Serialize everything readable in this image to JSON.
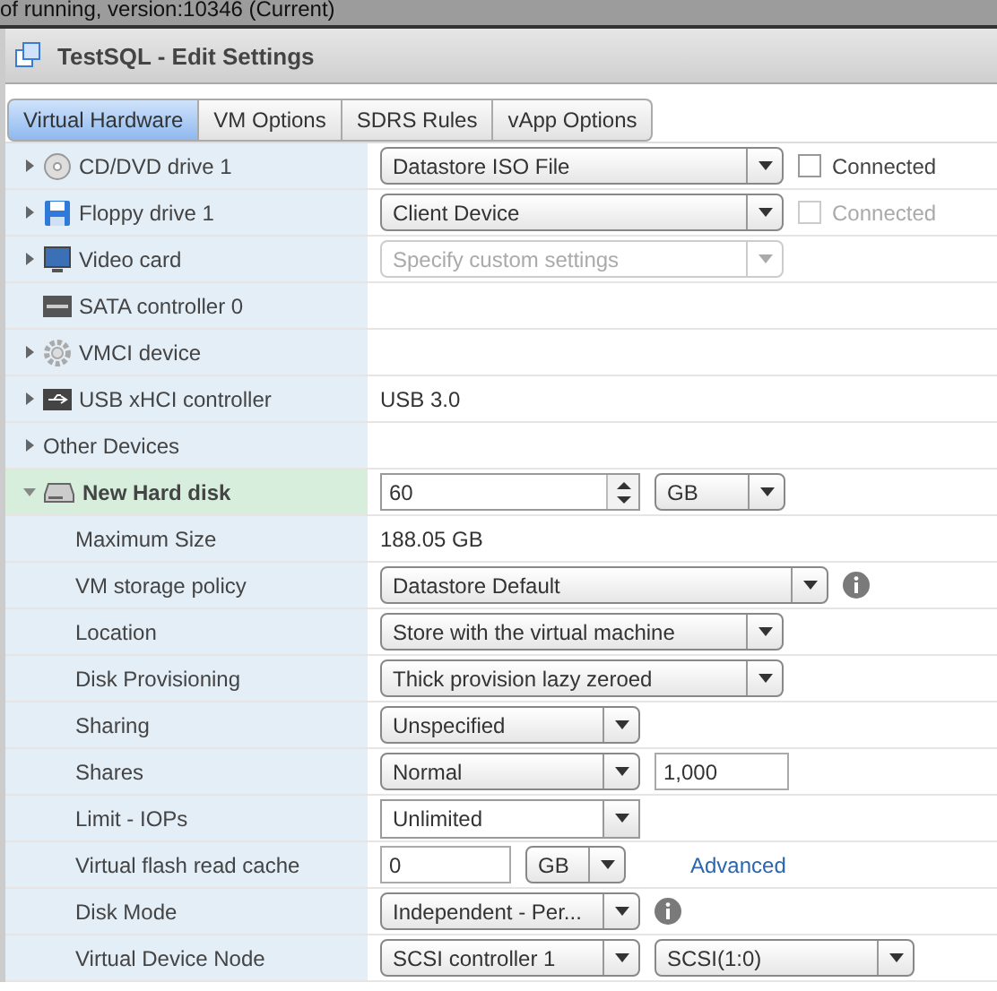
{
  "background_text": "of running, version:10346 (Current)",
  "window": {
    "title": "TestSQL - Edit Settings"
  },
  "tabs": [
    {
      "label": "Virtual Hardware",
      "selected": true
    },
    {
      "label": "VM Options",
      "selected": false
    },
    {
      "label": "SDRS Rules",
      "selected": false
    },
    {
      "label": "vApp Options",
      "selected": false
    }
  ],
  "devices": [
    {
      "kind": "cd-drive",
      "label": "CD/DVD drive 1",
      "expanded": false,
      "selected": false,
      "controls": [
        {
          "kind": "dropdown",
          "value": "Datastore ISO File",
          "disabled": false
        },
        {
          "kind": "checkbox",
          "label": "Connected",
          "checked": false,
          "disabled": false
        }
      ]
    },
    {
      "kind": "floppy",
      "label": "Floppy drive 1",
      "expanded": false,
      "selected": false,
      "controls": [
        {
          "kind": "dropdown",
          "value": "Client Device",
          "disabled": false
        },
        {
          "kind": "checkbox",
          "label": "Connected",
          "checked": false,
          "disabled": true
        }
      ]
    },
    {
      "kind": "video-card",
      "label": "Video card",
      "expanded": false,
      "selected": false,
      "controls": [
        {
          "kind": "dropdown",
          "value": "Specify custom settings",
          "disabled": true
        }
      ]
    },
    {
      "kind": "sata",
      "label": "SATA controller 0",
      "selected": false
    },
    {
      "kind": "vmci",
      "label": "VMCI device",
      "expanded": false,
      "selected": false
    },
    {
      "kind": "usb",
      "label": "USB xHCI controller",
      "expanded": false,
      "selected": false,
      "controls": [
        {
          "kind": "value",
          "value": "USB 3.0"
        }
      ]
    },
    {
      "kind": "group",
      "label": "Other Devices",
      "expanded": false,
      "selected": false
    },
    {
      "kind": "hard-disk",
      "label": "New Hard disk",
      "expanded": true,
      "selected": true,
      "controls": [
        {
          "kind": "spinner",
          "value": "60"
        },
        {
          "kind": "unit-dropdown",
          "value": "GB",
          "disabled": false
        }
      ],
      "children": [
        {
          "label": "Maximum Size",
          "controls": [
            {
              "kind": "value",
              "value": "188.05 GB"
            }
          ]
        },
        {
          "label": "VM storage policy",
          "controls": [
            {
              "kind": "wide-dropdown",
              "value": "Datastore Default",
              "disabled": false
            },
            {
              "kind": "info"
            }
          ]
        },
        {
          "label": "Location",
          "controls": [
            {
              "kind": "dropdown",
              "value": "Store with the virtual machine",
              "disabled": false
            }
          ]
        },
        {
          "label": "Disk Provisioning",
          "controls": [
            {
              "kind": "dropdown",
              "value": "Thick provision lazy zeroed",
              "disabled": false
            }
          ]
        },
        {
          "label": "Sharing",
          "controls": [
            {
              "kind": "short-dropdown",
              "value": "Unspecified",
              "disabled": false
            }
          ]
        },
        {
          "label": "Shares",
          "controls": [
            {
              "kind": "short-dropdown",
              "value": "Normal",
              "disabled": false
            },
            {
              "kind": "field",
              "value": "1,000"
            }
          ]
        },
        {
          "label": "Limit - IOPs",
          "controls": [
            {
              "kind": "combo",
              "value": "Unlimited"
            }
          ]
        },
        {
          "label": "Virtual flash read cache",
          "controls": [
            {
              "kind": "small-field",
              "value": "0"
            },
            {
              "kind": "mini-dropdown",
              "value": "GB",
              "disabled": false
            },
            {
              "kind": "link",
              "label": "Advanced"
            }
          ]
        },
        {
          "label": "Disk Mode",
          "controls": [
            {
              "kind": "short-dropdown",
              "value": "Independent - Per...",
              "disabled": false
            },
            {
              "kind": "info"
            }
          ]
        },
        {
          "label": "Virtual Device Node",
          "controls": [
            {
              "kind": "short-dropdown",
              "value": "SCSI controller 1",
              "disabled": false
            },
            {
              "kind": "short-dropdown",
              "value": "SCSI(1:0)",
              "disabled": false
            }
          ]
        }
      ]
    }
  ]
}
